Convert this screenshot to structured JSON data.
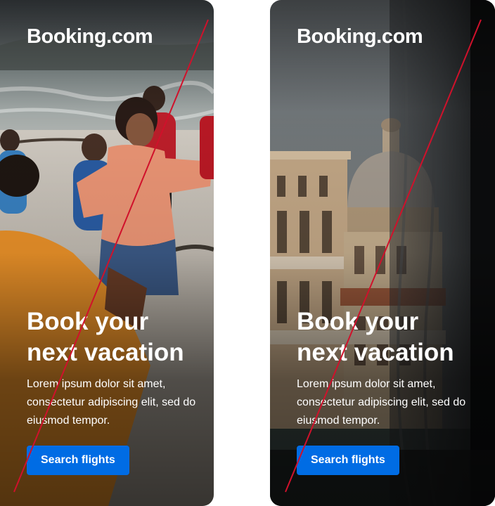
{
  "cards": [
    {
      "logo": "Booking.com",
      "headline_line1": "Book your",
      "headline_line2": "next vacation",
      "body": "Lorem ipsum dolor sit amet, consectetur adipiscing elit, sed do eiusmod tempor.",
      "cta": "Search flights",
      "photo": "beach-kids-photo"
    },
    {
      "logo": "Booking.com",
      "headline_line1": "Book your",
      "headline_line2": "next vacation",
      "body": "Lorem ipsum dolor sit amet, consectetur adipiscing elit, sed do eiusmod tempor.",
      "cta": "Search flights",
      "photo": "venice-window-photo"
    }
  ],
  "colors": {
    "cta_background": "#006ce4",
    "strike_line": "#d0112b",
    "text": "#ffffff"
  }
}
